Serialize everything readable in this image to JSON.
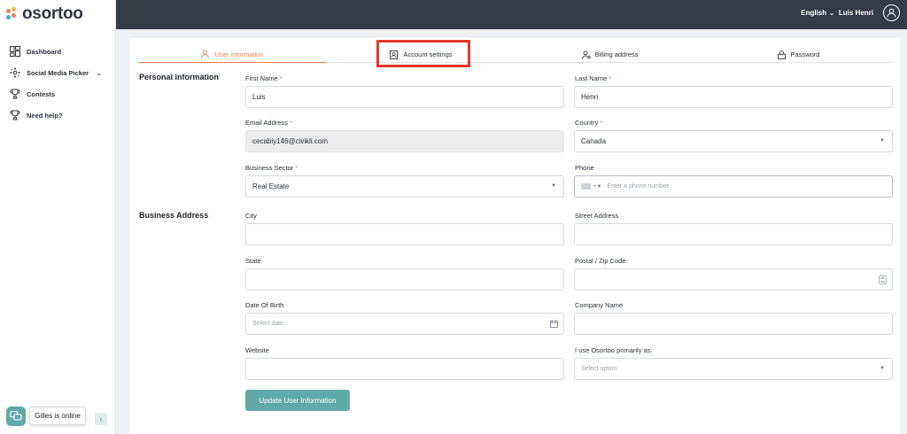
{
  "app": {
    "logo_text": "osortoo"
  },
  "sidebar": {
    "items": [
      {
        "label": "Dashboard"
      },
      {
        "label": "Social Media Picker"
      },
      {
        "label": "Contests"
      },
      {
        "label": "Need help?"
      }
    ],
    "chat_status": "Gilles is online"
  },
  "topbar": {
    "language": "English",
    "user_name": "Luis Henri"
  },
  "tabs": [
    {
      "label": "User information",
      "active": true
    },
    {
      "label": "Account settings",
      "active": false
    },
    {
      "label": "Billing address",
      "active": false
    },
    {
      "label": "Password",
      "active": false
    }
  ],
  "sections": {
    "personal": "Personal information",
    "business": "Business Address"
  },
  "form": {
    "first_name": {
      "label": "First Name",
      "value": "Luis"
    },
    "last_name": {
      "label": "Last Name",
      "value": "Henri"
    },
    "email": {
      "label": "Email Address",
      "value": "cecabiy146@civikli.com"
    },
    "country": {
      "label": "Country",
      "value": "Canada"
    },
    "business_sector": {
      "label": "Business Sector",
      "value": "Real Estate"
    },
    "phone": {
      "label": "Phone",
      "placeholder": "Enter a phone number",
      "code": "+"
    },
    "city": {
      "label": "City",
      "value": ""
    },
    "street": {
      "label": "Street Address",
      "value": ""
    },
    "state": {
      "label": "State",
      "value": ""
    },
    "postal": {
      "label": "Postal / Zip Code",
      "value": ""
    },
    "dob": {
      "label": "Date Of Birth",
      "placeholder": "Select date"
    },
    "company": {
      "label": "Company Name",
      "value": ""
    },
    "website": {
      "label": "Website",
      "value": ""
    },
    "use_as": {
      "label": "I use Osortoo primarily as:",
      "placeholder": "Select option"
    }
  },
  "submit_label": "Update User Information",
  "colors": {
    "accent": "#e8805f",
    "teal": "#5fa9a6",
    "topbar": "#363c46",
    "highlight": "#e33a2b"
  }
}
